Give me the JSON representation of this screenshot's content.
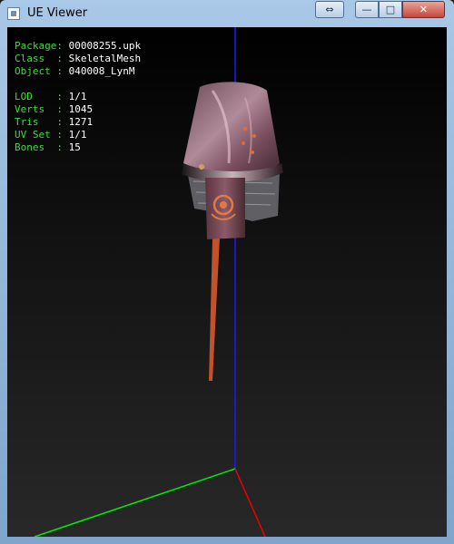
{
  "window": {
    "title": "UE Viewer",
    "controls": {
      "minimize": "—",
      "maximize": "□",
      "close": "✕",
      "switch": "⇔"
    }
  },
  "info": {
    "package": {
      "label": "Package:",
      "value": "00008255.upk"
    },
    "class": {
      "label": "Class  :",
      "value": "SkeletalMesh"
    },
    "object": {
      "label": "Object :",
      "value": "040008_LynM"
    },
    "lod": {
      "label": "LOD    :",
      "value": "1/1"
    },
    "verts": {
      "label": "Verts  :",
      "value": "1045"
    },
    "tris": {
      "label": "Tris   :",
      "value": "1271"
    },
    "uvset": {
      "label": "UV Set :",
      "value": "1/1"
    },
    "bones": {
      "label": "Bones  :",
      "value": "15"
    }
  },
  "colors": {
    "label": "#3ddc3d",
    "axis_x": "#ff0000",
    "axis_y": "#00ff00",
    "axis_z": "#0000ff",
    "mesh": "#8a5a6a"
  },
  "icons": {
    "app": "ue-viewer-app-icon"
  }
}
